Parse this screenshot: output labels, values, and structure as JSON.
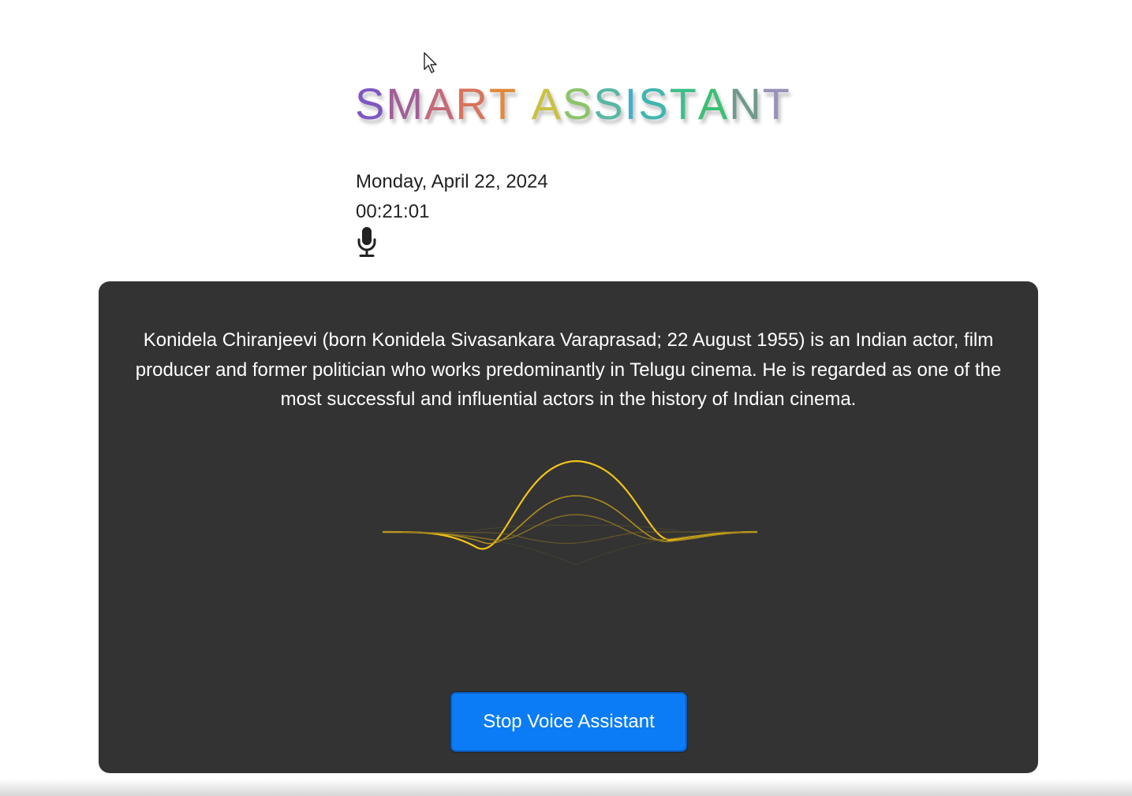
{
  "title": {
    "text": "SMART ASSISTANT",
    "letters": [
      {
        "char": "S",
        "color": "#7e57c2"
      },
      {
        "char": "M",
        "color": "#a15f97"
      },
      {
        "char": "A",
        "color": "#c46a7a"
      },
      {
        "char": "R",
        "color": "#d8745c"
      },
      {
        "char": "T",
        "color": "#e08a3e"
      },
      {
        "char": " ",
        "color": "#ffffff"
      },
      {
        "char": "A",
        "color": "#c9c141"
      },
      {
        "char": "S",
        "color": "#8cc46a"
      },
      {
        "char": "S",
        "color": "#57b8a2"
      },
      {
        "char": "I",
        "color": "#44b0c8"
      },
      {
        "char": "S",
        "color": "#3fb6b0"
      },
      {
        "char": "T",
        "color": "#3fbf8a"
      },
      {
        "char": "A",
        "color": "#3cbf75"
      },
      {
        "char": "N",
        "color": "#6f9a8c"
      },
      {
        "char": "T",
        "color": "#9a93b8"
      }
    ]
  },
  "date": "Monday, April 22, 2024",
  "time": "00:21:01",
  "mic_icon": "microphone-icon",
  "response_text": "Konidela Chiranjeevi (born Konidela Sivasankara Varaprasad; 22 August 1955) is an Indian actor, film producer and former politician who works predominantly in Telugu cinema. He is regarded as one of the most successful and influential actors in the history of Indian cinema.",
  "stop_button_label": "Stop Voice Assistant",
  "colors": {
    "panel": "#333333",
    "button": "#0b7cf5",
    "wave": "#f2c318"
  }
}
